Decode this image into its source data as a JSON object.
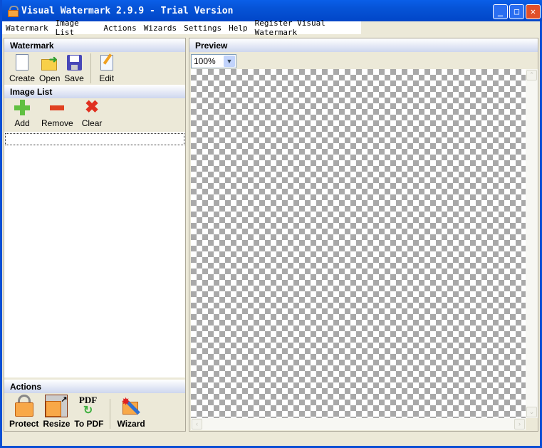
{
  "window": {
    "title": "Visual Watermark 2.9.9 - Trial Version",
    "controls": [
      "minimize",
      "maximize",
      "close"
    ]
  },
  "menu": [
    "Watermark",
    "Image List",
    "Actions",
    "Wizards",
    "Settings",
    "Help",
    "Register Visual Watermark"
  ],
  "watermark": {
    "header": "Watermark",
    "tools": [
      {
        "label": "Create",
        "icon": "new-document-icon"
      },
      {
        "label": "Open",
        "icon": "open-folder-icon"
      },
      {
        "label": "Save",
        "icon": "floppy-disk-icon"
      },
      {
        "label": "Edit",
        "icon": "edit-pencil-icon"
      }
    ]
  },
  "image_list": {
    "header": "Image List",
    "tools": [
      {
        "label": "Add",
        "icon": "plus-icon"
      },
      {
        "label": "Remove",
        "icon": "minus-icon"
      },
      {
        "label": "Clear",
        "icon": "x-icon"
      }
    ],
    "items": []
  },
  "actions": {
    "header": "Actions",
    "tools": [
      {
        "label": "Protect",
        "icon": "padlock-icon"
      },
      {
        "label": "Resize",
        "icon": "resize-icon"
      },
      {
        "label": "To PDF",
        "icon": "pdf-icon",
        "icon_text": "PDF"
      },
      {
        "label": "Wizard",
        "icon": "magic-wand-icon"
      }
    ]
  },
  "preview": {
    "header": "Preview",
    "zoom": "100%"
  }
}
